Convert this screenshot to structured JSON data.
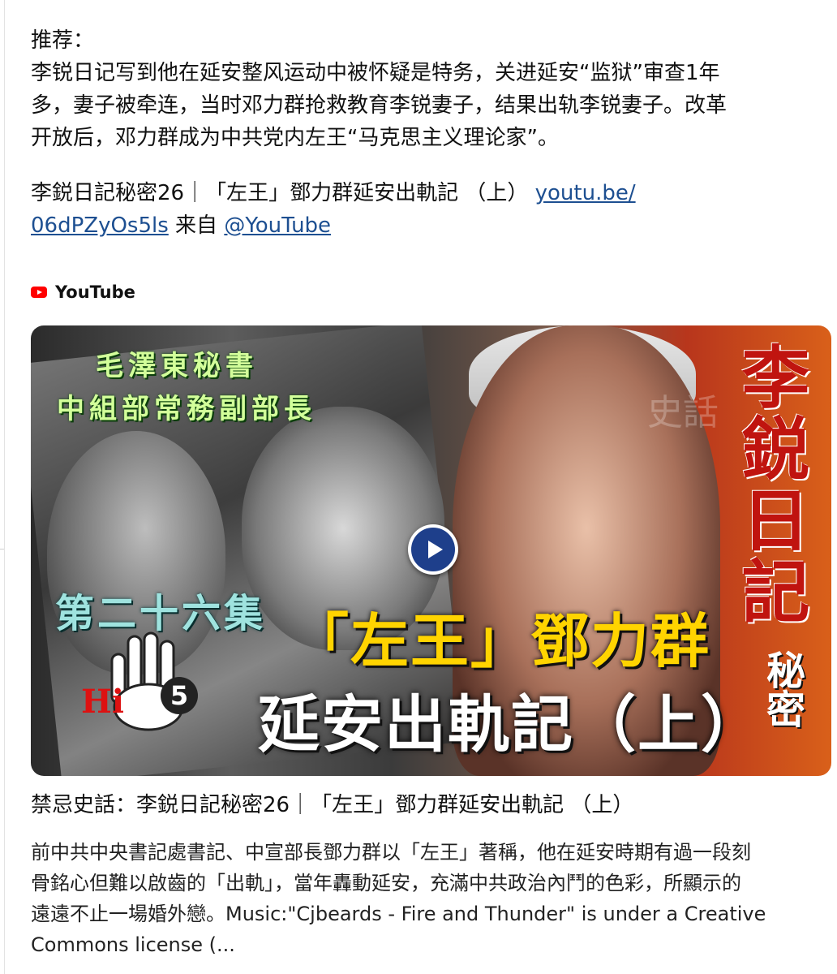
{
  "post": {
    "label": "推荐：",
    "body": "李锐日记写到他在延安整风运动中被怀疑是特务，关进延安“监狱”审查1年\n多，妻子被牵连，当时邓力群抢救教育李锐妻子，结果出轨李锐妻子。改革\n开放后，邓力群成为中共党内左王“马克思主义理论家”。",
    "share_text": "李鋭日記秘密26｜「左王」鄧力群延安出軌記 （上） ",
    "link_part1": "youtu.be/",
    "link_part2": "06dPZyOs5ls",
    "from_text": " 来自 ",
    "mention": "@YouTube"
  },
  "source": {
    "name": "YouTube",
    "icon": "youtube-logo-icon"
  },
  "thumbnail": {
    "top_line1": "毛澤東秘書",
    "top_line2": "中組部常務副部長",
    "episode": "第二十六集",
    "main_title": "「左王」鄧力群",
    "sub_title": "延安出軌記（上）",
    "series_title": "李鋭日記",
    "secret": "秘密",
    "hi_text": "Hi",
    "five": "5",
    "watermark": "史話",
    "accent_red": "#c0140f",
    "accent_yellow": "#ffd400",
    "play_blue": "#1e3f8b"
  },
  "card": {
    "title": "禁忌史話：李鋭日記秘密26｜「左王」鄧力群延安出軌記 （上）",
    "description": "前中共中央書記處書記、中宣部長鄧力群以「左王」著稱，他在延安時期有過一段刻\n骨銘心但難以啟齒的「出軌」，當年轟動延安，充滿中共政治內鬥的色彩，所顯示的\n遠遠不止一場婚外戀。Music:\"Cjbeards - Fire and Thunder\" is under a Creative\nCommons license (..."
  }
}
